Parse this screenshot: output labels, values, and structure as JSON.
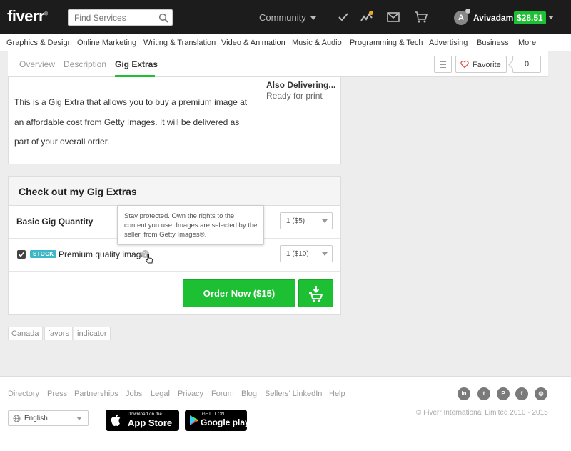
{
  "header": {
    "logo": "fiverr",
    "logo_mark": "®",
    "search_placeholder": "Find Services",
    "community_label": "Community",
    "avatar_initial": "A",
    "username": "Avivadam",
    "balance": "$28.51"
  },
  "categories": [
    "Graphics & Design",
    "Online Marketing",
    "Writing & Translation",
    "Video & Animation",
    "Music & Audio",
    "Programming & Tech",
    "Advertising",
    "Business",
    "More"
  ],
  "tabs": [
    "Overview",
    "Description",
    "Gig Extras"
  ],
  "favorite": {
    "label": "Favorite",
    "count": "0"
  },
  "description": {
    "text": "This is a Gig Extra that allows you to buy a premium image at an affordable cost from Getty Images. It will be delivered as part of your overall order.",
    "also_delivering_title": "Also Delivering...",
    "also_delivering_value": "Ready for print"
  },
  "extras": {
    "title": "Check out my Gig Extras",
    "basic_quantity_label": "Basic Gig Quantity",
    "basic_quantity_value": "1 ($5)",
    "stock_badge": "STOCK",
    "premium_label": "Premium quality image",
    "premium_quantity_value": "1 ($10)",
    "premium_checked": true,
    "tooltip": "Stay protected. Own the rights to the content you use. Images are selected by the seller, from Getty Images®.",
    "help_icon": "?",
    "order_button": "Order Now ($15)"
  },
  "tags": [
    "Canada",
    "favors",
    "indicator"
  ],
  "footer": {
    "links": [
      "Directory",
      "Press",
      "Partnerships",
      "Jobs",
      "Legal",
      "Privacy",
      "Forum",
      "Blog",
      "Sellers' LinkedIn",
      "Help"
    ],
    "social": [
      {
        "icon": "linkedin-icon",
        "glyph": "in"
      },
      {
        "icon": "twitter-icon",
        "glyph": "t"
      },
      {
        "icon": "pinterest-icon",
        "glyph": "P"
      },
      {
        "icon": "facebook-icon",
        "glyph": "f"
      },
      {
        "icon": "instagram-icon",
        "glyph": "◎"
      }
    ],
    "language": "English",
    "app_store_small": "Download on the",
    "app_store_big": "App Store",
    "google_play_small": "GET IT ON",
    "google_play_big": "Google play",
    "copyright": "© Fiverr International Limited 2010 - 2015"
  },
  "colors": {
    "brand_green": "#1dbf33",
    "stock_badge": "#3db6c6",
    "header_bg": "#1c1c1c"
  }
}
